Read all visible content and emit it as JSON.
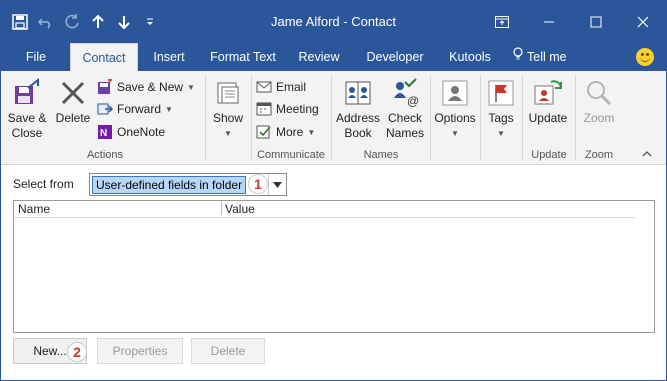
{
  "window": {
    "title": "Jame Alford  -  Contact"
  },
  "tabs": [
    "File",
    "Contact",
    "Insert",
    "Format Text",
    "Review",
    "Developer",
    "Kutools",
    "Tell me"
  ],
  "ribbon": {
    "actions": {
      "save_close": "Save &",
      "save_close_2": "Close",
      "delete": "Delete",
      "save_new": "Save & New",
      "forward": "Forward",
      "onenote": "OneNote",
      "group_label": "Actions"
    },
    "show": {
      "label": "Show"
    },
    "communicate": {
      "email": "Email",
      "meeting": "Meeting",
      "more": "More",
      "group_label": "Communicate"
    },
    "names": {
      "address_book": "Address",
      "address_book_2": "Book",
      "check_names": "Check",
      "check_names_2": "Names",
      "group_label": "Names"
    },
    "options": {
      "label": "Options"
    },
    "tags": {
      "label": "Tags"
    },
    "update": {
      "label": "Update",
      "group_label": "Update"
    },
    "zoom": {
      "label": "Zoom",
      "group_label": "Zoom"
    }
  },
  "dialog": {
    "select_from_label": "Select from",
    "select_from_value": "User-defined fields in folder",
    "step1": "1",
    "step2": "2",
    "columns": [
      "Name",
      "Value"
    ],
    "buttons": {
      "new": "New...",
      "properties": "Properties",
      "delete": "Delete"
    }
  },
  "colors": {
    "accent": "#2b579a",
    "badge": "#d0332a",
    "selection": "#b8d6f5"
  }
}
